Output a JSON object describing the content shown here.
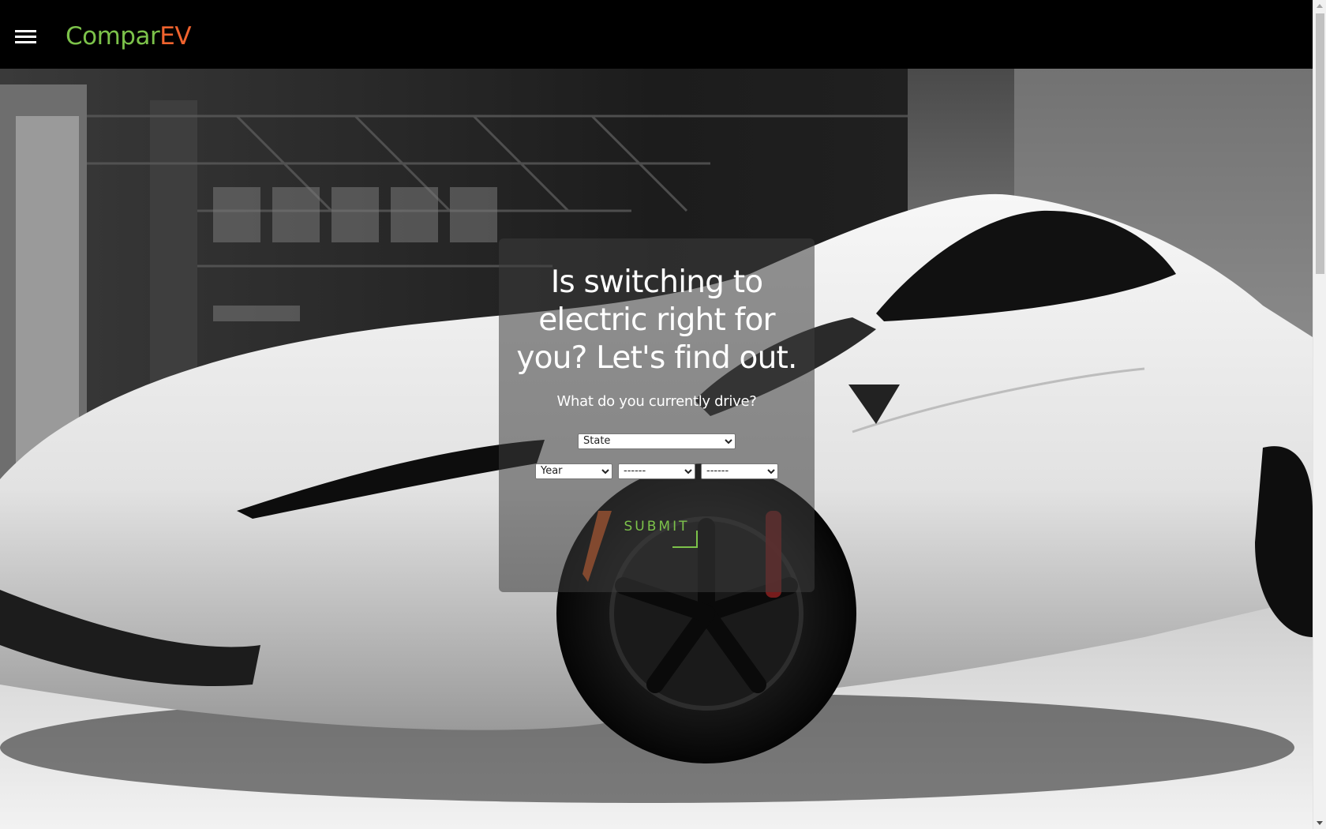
{
  "header": {
    "brand_part1": "Compar",
    "brand_part2": "EV",
    "brand_colors": {
      "primary": "#7cc24a",
      "accent": "#f0632e"
    },
    "menu_icon": "hamburger-icon"
  },
  "hero": {
    "headline": "Is switching to electric right for you? Let's find out.",
    "subheadline": "What do you currently drive?"
  },
  "form": {
    "state_select": "State",
    "year_select": "Year",
    "make_select": "------",
    "model_select": "------",
    "submit_label": "SUBMIT"
  }
}
